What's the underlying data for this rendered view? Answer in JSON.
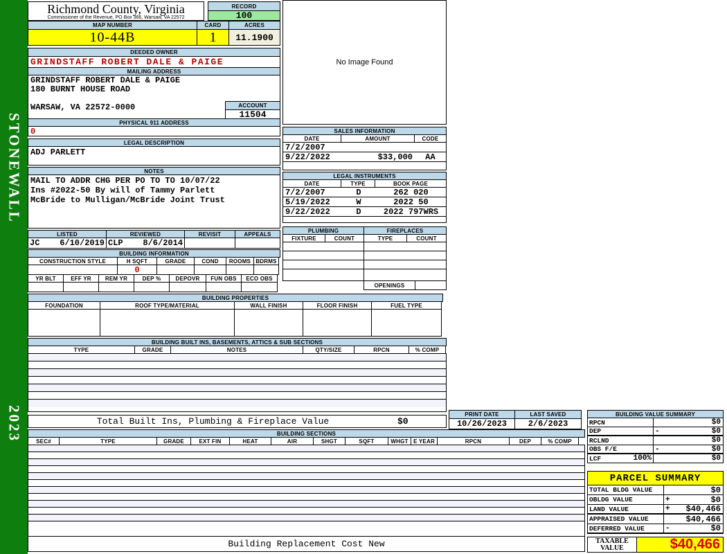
{
  "colors": {
    "header_blue": "#BDD8E8",
    "sidebar_green": "#0E7E0E",
    "highlight_yellow": "#FFFF00",
    "record_green": "#9FE79F",
    "acres_cream": "#F0EFE0",
    "alert_red": "#C00000",
    "stripe_lavender": "#F3F3FB"
  },
  "sidebar": {
    "district": "STONEWALL",
    "year": "2023"
  },
  "header": {
    "county": "Richmond County, Virginia",
    "commissioner": "Commissioner of the Revenue, PO Box 366, Warsaw, VA 22572",
    "record_label": "RECORD",
    "record_value": "100",
    "map_label": "MAP NUMBER",
    "map_value": "10-44B",
    "card_label": "CARD",
    "card_value": "1",
    "acres_label": "ACRES",
    "acres_value": "11.1900"
  },
  "owner": {
    "deeded_label": "DEEDED OWNER",
    "deeded_name": "GRINDSTAFF ROBERT DALE & PAIGE",
    "mailing_label": "MAILING ADDRESS",
    "address_line1": "GRINDSTAFF ROBERT DALE & PAIGE",
    "address_line2": "180 BURNT HOUSE ROAD",
    "address_city": "WARSAW, VA 22572-0000",
    "account_label": "ACCOUNT",
    "account_value": "11504",
    "physical_label": "PHYSICAL 911 ADDRESS",
    "physical_value": "0",
    "legal_label": "LEGAL DESCRIPTION",
    "legal_value": "ADJ PARLETT"
  },
  "photo": {
    "no_image": "No Image Found"
  },
  "notes": {
    "label": "NOTES",
    "line1": "MAIL TO ADDR CHG PER PO TO TO 10/07/22",
    "line2": "Ins #2022-50 By will of Tammy Parlett",
    "line3": "McBride to Mulligan/McBride Joint Trust"
  },
  "review": {
    "listed_label": "LISTED",
    "reviewed_label": "REVIEWED",
    "revisit_label": "REVISIT",
    "appeals_label": "APPEALS",
    "listed_by": "JC",
    "listed_date": "6/10/2019",
    "reviewed_by": "CLP",
    "reviewed_date": "8/6/2014"
  },
  "building_info": {
    "label": "BUILDING INFORMATION",
    "h1": [
      "CONSTRUCTION STYLE",
      "H SQFT",
      "GRADE",
      "COND",
      "ROOMS",
      "BDRMS"
    ],
    "h_sqft_value": "0",
    "h2": [
      "YR BLT",
      "EFF YR",
      "REM YR",
      "DEP %",
      "DEPOVR",
      "FUN OBS",
      "ECO OBS"
    ]
  },
  "building_props": {
    "label": "BUILDING PROPERTIES",
    "headers": [
      "FOUNDATION",
      "ROOF TYPE/MATERIAL",
      "WALL FINISH",
      "FLOOR FINISH",
      "FUEL TYPE"
    ]
  },
  "sales": {
    "label": "SALES INFORMATION",
    "headers": [
      "DATE",
      "AMOUNT",
      "CODE"
    ],
    "rows": [
      {
        "date": "7/2/2007",
        "amount": "",
        "code": ""
      },
      {
        "date": "9/22/2022",
        "amount": "$33,000",
        "code": "AA"
      }
    ]
  },
  "instruments": {
    "label": "LEGAL INSTRUMENTS",
    "headers": [
      "DATE",
      "TYPE",
      "BOOK PAGE"
    ],
    "rows": [
      {
        "date": "7/2/2007",
        "type": "D",
        "book": "262 020"
      },
      {
        "date": "5/19/2022",
        "type": "W",
        "book": "2022 50"
      },
      {
        "date": "9/22/2022",
        "type": "D",
        "book": "2022 797WRS"
      }
    ]
  },
  "plumbing": {
    "label": "PLUMBING",
    "fixture": "FIXTURE",
    "count": "COUNT"
  },
  "fireplaces": {
    "label": "FIREPLACES",
    "type": "TYPE",
    "count": "COUNT",
    "openings": "OPENINGS"
  },
  "built_ins": {
    "label": "BUILDING BUILT INS, BASEMENTS, ATTICS & SUB SECTIONS",
    "headers": [
      "TYPE",
      "GRADE",
      "NOTES",
      "QTY/SIZE",
      "RPCN",
      "% COMP"
    ],
    "total_label": "Total Built Ins, Plumbing & Fireplace Value",
    "total_value": "$0"
  },
  "print_info": {
    "print_label": "PRINT DATE",
    "print_value": "10/26/2023",
    "saved_label": "LAST SAVED",
    "saved_value": "2/6/2023"
  },
  "bvs": {
    "label": "BUILDING VALUE SUMMARY",
    "rows": [
      {
        "name": "RPCN",
        "op": "",
        "value": "$0"
      },
      {
        "name": "DEP",
        "op": "-",
        "value": "$0"
      },
      {
        "name": "RCLND",
        "op": "",
        "value": "$0"
      },
      {
        "name": "OBS F/E",
        "op": "-",
        "value": "$0"
      },
      {
        "name": "LCF",
        "pct": "100%",
        "op": "",
        "value": "$0"
      }
    ]
  },
  "sections": {
    "label": "BUILDING SECTIONS",
    "headers": [
      "SEC#",
      "TYPE",
      "GRADE",
      "EXT FIN",
      "HEAT",
      "AIR",
      "SHGT",
      "SQFT",
      "WHGT",
      "E YEAR",
      "RPCN",
      "DEP",
      "% COMP"
    ],
    "footer": "Building Replacement Cost New"
  },
  "parcel": {
    "label": "PARCEL SUMMARY",
    "rows": [
      {
        "name": "TOTAL BLDG VALUE",
        "op": "",
        "value": "$0"
      },
      {
        "name": "OBLDG VALUE",
        "op": "+",
        "value": "$0"
      },
      {
        "name": "LAND VALUE",
        "op": "+",
        "value": "$40,466"
      },
      {
        "name": "APPRAISED VALUE",
        "op": "",
        "value": "$40,466"
      },
      {
        "name": "DEFERRED VALUE",
        "op": "-",
        "value": "$0"
      }
    ],
    "taxable_label": "TAXABLE VALUE",
    "taxable_value": "$40,466"
  }
}
